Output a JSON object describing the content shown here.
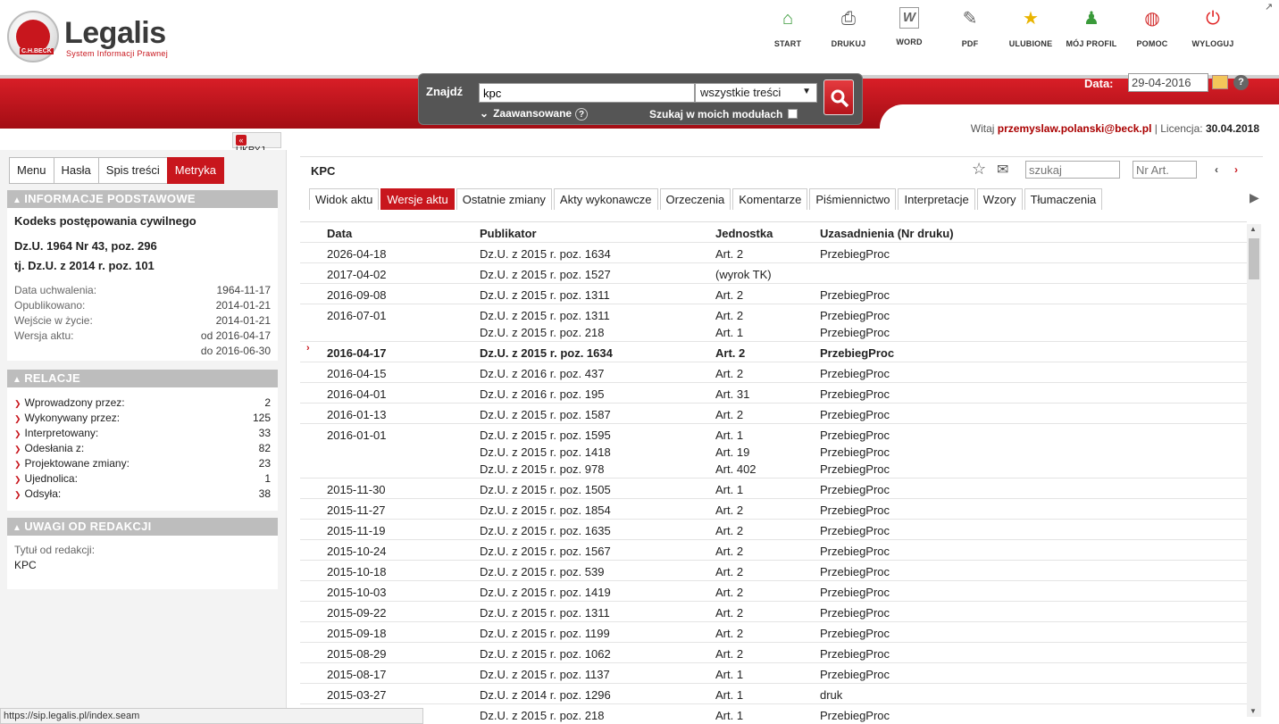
{
  "brand": {
    "name": "Legalis",
    "tagline": "System Informacji Prawnej",
    "seal_text": "C.H.BECK"
  },
  "toolbar": [
    {
      "label": "START",
      "icon": "house-icon"
    },
    {
      "label": "DRUKUJ",
      "icon": "printer-icon"
    },
    {
      "label": "WORD",
      "icon": "word-icon"
    },
    {
      "label": "PDF",
      "icon": "pdf-icon"
    },
    {
      "label": "ULUBIONE",
      "icon": "star-icon"
    },
    {
      "label": "MÓJ PROFIL",
      "icon": "user-icon"
    },
    {
      "label": "POMOC",
      "icon": "lifebuoy-icon"
    },
    {
      "label": "WYLOGUJ",
      "icon": "power-icon"
    }
  ],
  "search": {
    "label": "Znajdź",
    "value": "kpc",
    "scope": "wszystkie treści",
    "advanced": "Zaawansowane",
    "modules": "Szukaj w moich modułach"
  },
  "date": {
    "label": "Data:",
    "value": "29-04-2016"
  },
  "welcome": {
    "prefix": "Witaj",
    "user": "przemyslaw.polanski@beck.pl",
    "license_label": "| Licencja:",
    "license": "30.04.2018"
  },
  "sidebar": {
    "hide_label": "UKRYJ",
    "tabs": [
      "Menu",
      "Hasła",
      "Spis treści",
      "Metryka"
    ],
    "active_tab": "Metryka",
    "info": {
      "heading": "INFORMACJE PODSTAWOWE",
      "title": "Kodeks postępowania cywilnego",
      "du1": "Dz.U. 1964 Nr 43, poz. 296",
      "du2": "tj. Dz.U. z 2014 r. poz. 101",
      "fields": [
        {
          "k": "Data uchwalenia:",
          "v": "1964-11-17"
        },
        {
          "k": "Opublikowano:",
          "v": "2014-01-21"
        },
        {
          "k": "Wejście w życie:",
          "v": "2014-01-21"
        },
        {
          "k": "Wersja aktu:",
          "v": "od 2016-04-17"
        },
        {
          "k": "",
          "v": "do 2016-06-30"
        }
      ]
    },
    "relations": {
      "heading": "RELACJE",
      "items": [
        {
          "k": "Wprowadzony przez:",
          "v": "2"
        },
        {
          "k": "Wykonywany przez:",
          "v": "125"
        },
        {
          "k": "Interpretowany:",
          "v": "33"
        },
        {
          "k": "Odesłania z:",
          "v": "82"
        },
        {
          "k": "Projektowane zmiany:",
          "v": "23"
        },
        {
          "k": "Ujednolica:",
          "v": "1"
        },
        {
          "k": "Odsyła:",
          "v": "38"
        }
      ]
    },
    "notes": {
      "heading": "UWAGI OD REDAKCJI",
      "k": "Tytuł od redakcji:",
      "v": "KPC"
    }
  },
  "main": {
    "title": "KPC",
    "find_placeholder": "szukaj",
    "art_placeholder": "Nr Art.",
    "tabs": [
      "Widok aktu",
      "Wersje aktu",
      "Ostatnie zmiany",
      "Akty wykonawcze",
      "Orzeczenia",
      "Komentarze",
      "Piśmiennictwo",
      "Interpretacje",
      "Wzory",
      "Tłumaczenia"
    ],
    "active_tab": "Wersje aktu",
    "columns": [
      "Data",
      "Publikator",
      "Jednostka",
      "Uzasadnienia (Nr druku)"
    ],
    "rows": [
      {
        "date": "2026-04-18",
        "lines": [
          [
            "Dz.U. z 2015 r. poz. 1634",
            "Art. 2",
            "PrzebiegProc"
          ]
        ]
      },
      {
        "date": "2017-04-02",
        "lines": [
          [
            "Dz.U. z 2015 r. poz. 1527",
            "(wyrok TK)",
            ""
          ]
        ]
      },
      {
        "date": "2016-09-08",
        "lines": [
          [
            "Dz.U. z 2015 r. poz. 1311",
            "Art. 2",
            "PrzebiegProc"
          ]
        ]
      },
      {
        "date": "2016-07-01",
        "lines": [
          [
            "Dz.U. z 2015 r. poz. 1311",
            "Art. 2",
            "PrzebiegProc"
          ],
          [
            "Dz.U. z 2015 r. poz. 218",
            "Art. 1",
            "PrzebiegProc"
          ]
        ]
      },
      {
        "date": "2016-04-17",
        "current": true,
        "lines": [
          [
            "Dz.U. z 2015 r. poz. 1634",
            "Art. 2",
            "PrzebiegProc"
          ]
        ]
      },
      {
        "date": "2016-04-15",
        "lines": [
          [
            "Dz.U. z 2016 r. poz. 437",
            "Art. 2",
            "PrzebiegProc"
          ]
        ]
      },
      {
        "date": "2016-04-01",
        "lines": [
          [
            "Dz.U. z 2016 r. poz. 195",
            "Art. 31",
            "PrzebiegProc"
          ]
        ]
      },
      {
        "date": "2016-01-13",
        "lines": [
          [
            "Dz.U. z 2015 r. poz. 1587",
            "Art. 2",
            "PrzebiegProc"
          ]
        ]
      },
      {
        "date": "2016-01-01",
        "lines": [
          [
            "Dz.U. z 2015 r. poz. 1595",
            "Art. 1",
            "PrzebiegProc"
          ],
          [
            "Dz.U. z 2015 r. poz. 1418",
            "Art. 19",
            "PrzebiegProc"
          ],
          [
            "Dz.U. z 2015 r. poz. 978",
            "Art. 402",
            "PrzebiegProc"
          ]
        ]
      },
      {
        "date": "2015-11-30",
        "lines": [
          [
            "Dz.U. z 2015 r. poz. 1505",
            "Art. 1",
            "PrzebiegProc"
          ]
        ]
      },
      {
        "date": "2015-11-27",
        "lines": [
          [
            "Dz.U. z 2015 r. poz. 1854",
            "Art. 2",
            "PrzebiegProc"
          ]
        ]
      },
      {
        "date": "2015-11-19",
        "lines": [
          [
            "Dz.U. z 2015 r. poz. 1635",
            "Art. 2",
            "PrzebiegProc"
          ]
        ]
      },
      {
        "date": "2015-10-24",
        "lines": [
          [
            "Dz.U. z 2015 r. poz. 1567",
            "Art. 2",
            "PrzebiegProc"
          ]
        ]
      },
      {
        "date": "2015-10-18",
        "lines": [
          [
            "Dz.U. z 2015 r. poz. 539",
            "Art. 2",
            "PrzebiegProc"
          ]
        ]
      },
      {
        "date": "2015-10-03",
        "lines": [
          [
            "Dz.U. z 2015 r. poz. 1419",
            "Art. 2",
            "PrzebiegProc"
          ]
        ]
      },
      {
        "date": "2015-09-22",
        "lines": [
          [
            "Dz.U. z 2015 r. poz. 1311",
            "Art. 2",
            "PrzebiegProc"
          ]
        ]
      },
      {
        "date": "2015-09-18",
        "lines": [
          [
            "Dz.U. z 2015 r. poz. 1199",
            "Art. 2",
            "PrzebiegProc"
          ]
        ]
      },
      {
        "date": "2015-08-29",
        "lines": [
          [
            "Dz.U. z 2015 r. poz. 1062",
            "Art. 2",
            "PrzebiegProc"
          ]
        ]
      },
      {
        "date": "2015-08-17",
        "lines": [
          [
            "Dz.U. z 2015 r. poz. 1137",
            "Art. 1",
            "PrzebiegProc"
          ]
        ]
      },
      {
        "date": "2015-03-27",
        "lines": [
          [
            "Dz.U. z 2014 r. poz. 1296",
            "Art. 1",
            "druk"
          ]
        ]
      },
      {
        "date": "",
        "lines": [
          [
            "Dz.U. z 2015 r. poz. 218",
            "Art. 1",
            "PrzebiegProc"
          ]
        ]
      }
    ]
  },
  "status_url": "https://sip.legalis.pl/index.seam",
  "colors": {
    "brand_red": "#c8161d",
    "panel_grey": "#bdbdbd"
  }
}
